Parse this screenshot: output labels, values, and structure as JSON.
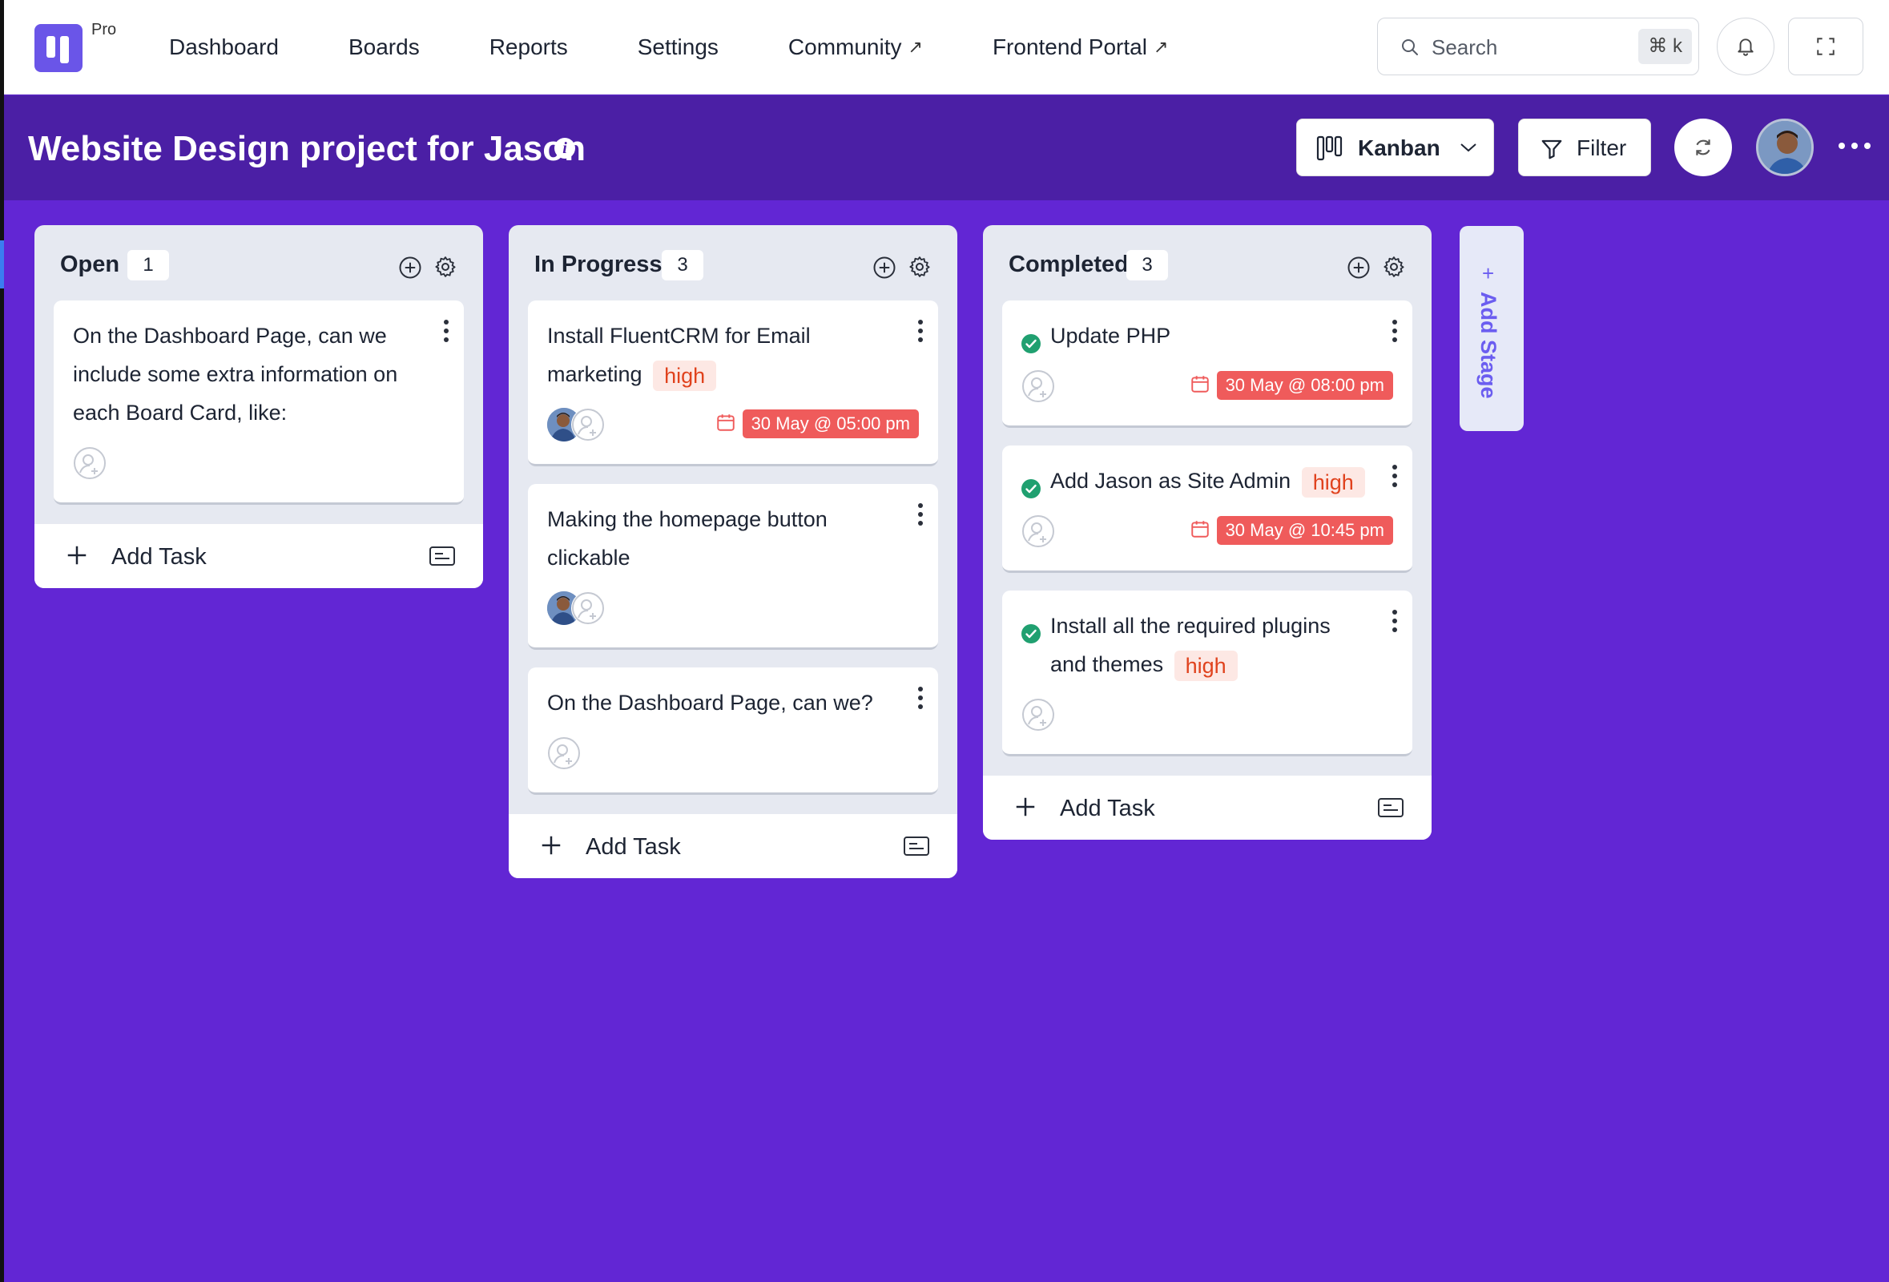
{
  "app": {
    "badge": "Pro"
  },
  "nav": {
    "items": [
      {
        "label": "Dashboard",
        "external": false
      },
      {
        "label": "Boards",
        "external": false
      },
      {
        "label": "Reports",
        "external": false
      },
      {
        "label": "Settings",
        "external": false
      },
      {
        "label": "Community",
        "external": true
      },
      {
        "label": "Frontend Portal",
        "external": true
      }
    ],
    "external_glyph": "↗",
    "search": {
      "label": "Search",
      "shortcut": "⌘ k"
    }
  },
  "board": {
    "title": "Website Design project for Jason",
    "info_glyph": "i",
    "view_label": "Kanban",
    "filter_label": "Filter"
  },
  "columns": [
    {
      "title": "Open",
      "count": "1",
      "add_task_label": "Add Task",
      "cards": [
        {
          "title": "On the Dashboard Page, can we include some extra information on each Board Card, like:",
          "completed": false,
          "priority": "",
          "assignee_avatar": false,
          "due": ""
        }
      ]
    },
    {
      "title": "In Progress",
      "count": "3",
      "add_task_label": "Add Task",
      "cards": [
        {
          "title": "Install FluentCRM for Email marketing",
          "completed": false,
          "priority": "high",
          "assignee_avatar": true,
          "due": "30 May @ 05:00 pm"
        },
        {
          "title": "Making the homepage button clickable",
          "completed": false,
          "priority": "",
          "assignee_avatar": true,
          "due": ""
        },
        {
          "title": "On the Dashboard Page, can we?",
          "completed": false,
          "priority": "",
          "assignee_avatar": false,
          "due": ""
        }
      ]
    },
    {
      "title": "Completed",
      "count": "3",
      "add_task_label": "Add Task",
      "cards": [
        {
          "title": "Update PHP",
          "completed": true,
          "priority": "",
          "assignee_avatar": false,
          "due": "30 May @ 08:00 pm"
        },
        {
          "title": "Add Jason as Site Admin",
          "completed": true,
          "priority": "high",
          "assignee_avatar": false,
          "due": "30 May @ 10:45 pm"
        },
        {
          "title": "Install all the required plugins and themes",
          "completed": true,
          "priority": "high",
          "assignee_avatar": false,
          "due": ""
        }
      ]
    }
  ],
  "add_stage": {
    "label": "Add Stage",
    "glyph": "+"
  },
  "colors": {
    "board_bg": "#6226d4",
    "header_bg": "#4b1fa5",
    "brand": "#6a55e8",
    "priority_text": "#e0421d",
    "due_bg": "#ef5b5b",
    "done_check": "#20a070"
  },
  "icons": [
    "logo-icon",
    "search-icon",
    "bell-icon",
    "fullscreen-icon",
    "info-icon",
    "kanban-icon",
    "chevron-down-icon",
    "filter-icon",
    "refresh-icon",
    "more-icon",
    "add-circle-icon",
    "gear-icon",
    "kebab-icon",
    "calendar-icon",
    "check-circle-icon",
    "add-assignee-icon",
    "plus-icon",
    "template-icon"
  ]
}
